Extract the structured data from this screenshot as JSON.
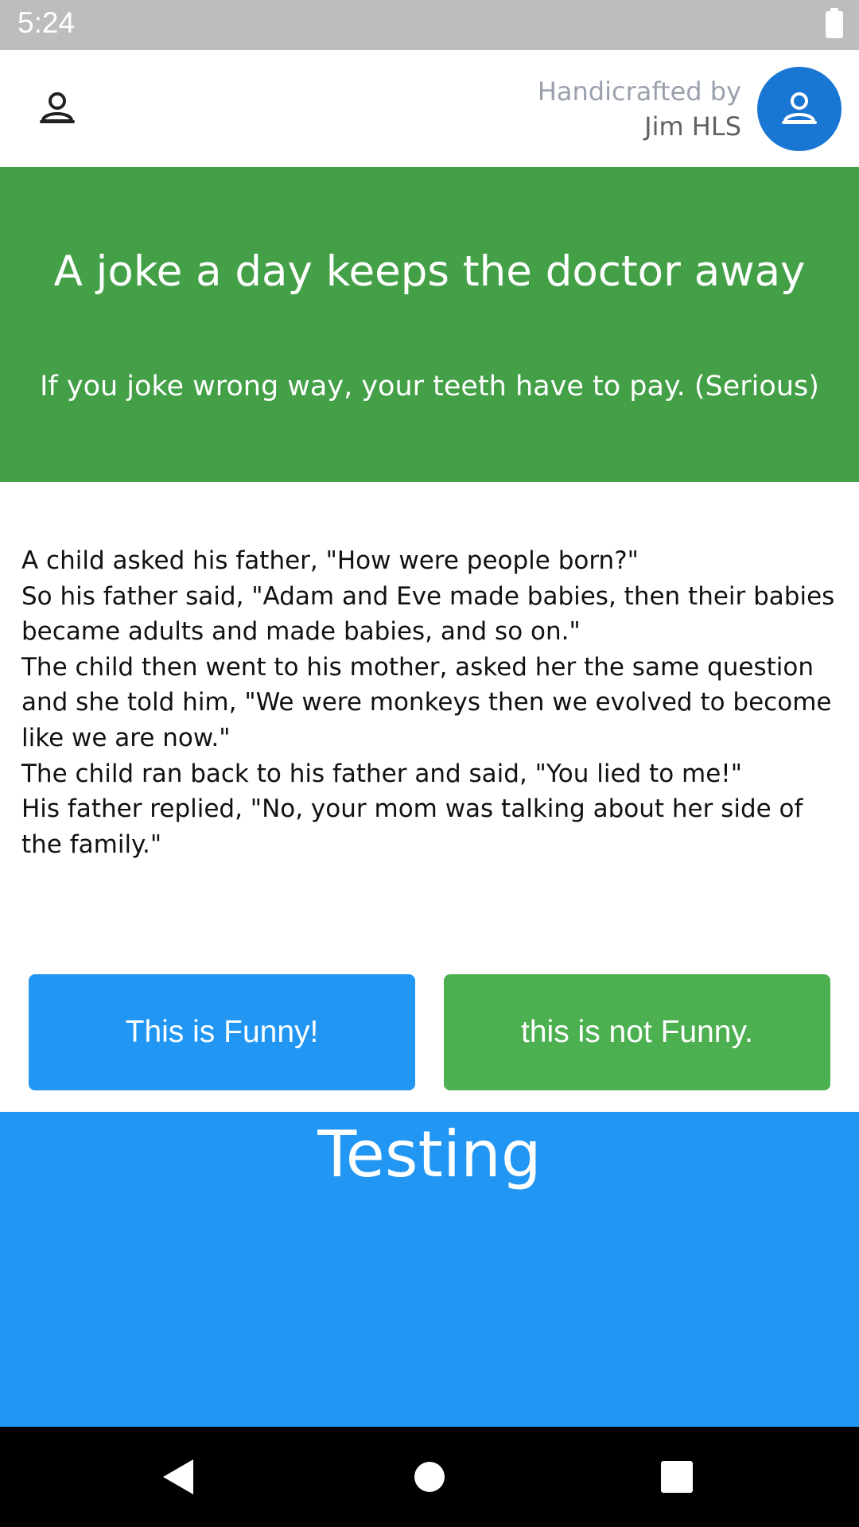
{
  "status_bar": {
    "time": "5:24",
    "battery_icon": "battery-full-icon"
  },
  "header": {
    "left_icon": "user-outline-icon",
    "credit_label": "Handicrafted by",
    "credit_name": "Jim HLS",
    "avatar_icon": "user-outline-icon",
    "avatar_color": "#1976d2"
  },
  "hero": {
    "title": "A joke a day keeps the doctor away",
    "subtitle": "If you joke wrong way, your teeth have to pay. (Serious)",
    "background": "#43a047"
  },
  "joke": {
    "lines": [
      "A child asked his father, \"How were people born?\"",
      "So his father said, \"Adam and Eve made babies, then their babies became adults and made babies, and so on.\"",
      "The child then went to his mother, asked her the same question and she told him, \"We were monkeys then we evolved to become like we are now.\"",
      "The child ran back to his father and said, \"You lied to me!\"",
      "His father replied, \"No, your mom was talking about her side of the family.\""
    ]
  },
  "buttons": {
    "funny_label": "This is Funny!",
    "funny_color": "#2196f3",
    "not_funny_label": "this is not Funny.",
    "not_funny_color": "#4caf50"
  },
  "testing": {
    "title": "Testing",
    "background": "#2196f3"
  },
  "nav_bar": {
    "back_icon": "back-triangle-icon",
    "home_icon": "home-circle-icon",
    "recents_icon": "recents-square-icon"
  }
}
